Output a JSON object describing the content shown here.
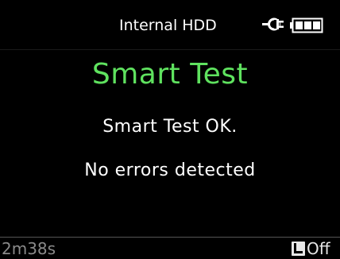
{
  "header": {
    "title": "Internal HDD",
    "icons": [
      "power-plug-icon",
      "battery-full-icon"
    ]
  },
  "main": {
    "title": "Smart Test",
    "messages": [
      "Smart Test OK.",
      "No errors detected"
    ]
  },
  "footer": {
    "time": "2m38s",
    "lock_icon": "lock-l-icon",
    "lock_state": "Off"
  },
  "colors": {
    "background": "#000000",
    "title": "#5fe25f",
    "text": "#ffffff",
    "footer_text": "#8a8a8a"
  }
}
